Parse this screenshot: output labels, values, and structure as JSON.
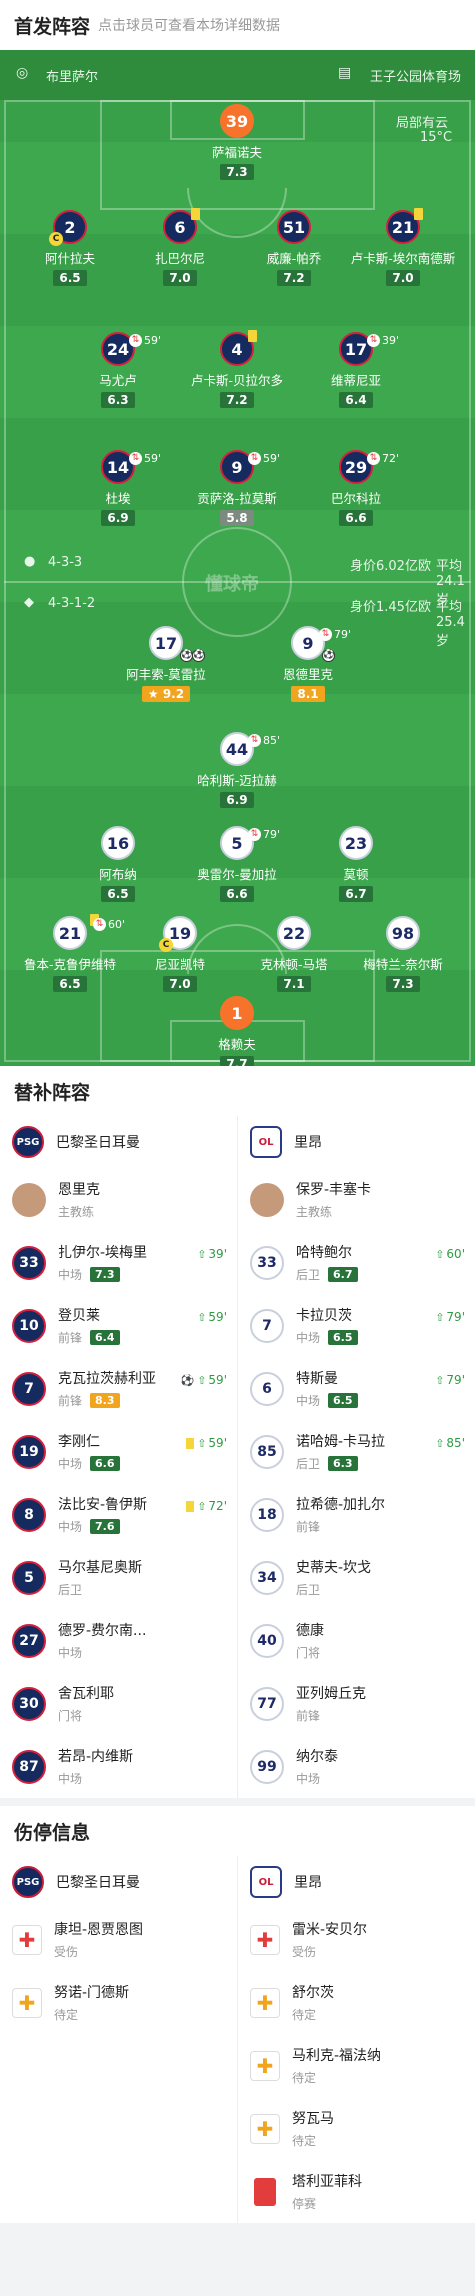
{
  "lineup_header": {
    "title": "首发阵容",
    "subtitle": "点击球员可查看本场详细数据"
  },
  "field": {
    "referee": "布里萨尔",
    "venue": "王子公园体育场",
    "weather": "局部有云",
    "temperature": "15°C",
    "watermark": "懂球帝",
    "psg_formation": "4-3-3",
    "psg_value": "身价6.02亿欧",
    "psg_age": "平均24.1岁",
    "lyon_formation": "4-3-1-2",
    "lyon_value": "身价1.45亿欧",
    "lyon_age": "平均25.4岁"
  },
  "psg_players": [
    {
      "num": "39",
      "name": "萨福诺夫",
      "rating": "7.3",
      "gk": true
    },
    {
      "num": "2",
      "name": "阿什拉夫",
      "rating": "6.5",
      "captain": true
    },
    {
      "num": "6",
      "name": "扎巴尔尼",
      "rating": "7.0",
      "card": true
    },
    {
      "num": "51",
      "name": "威廉-帕乔",
      "rating": "7.2"
    },
    {
      "num": "21",
      "name": "卢卡斯-埃尔南德斯",
      "rating": "7.0",
      "card": true
    },
    {
      "num": "24",
      "name": "马尤卢",
      "rating": "6.3",
      "sub": "59'"
    },
    {
      "num": "4",
      "name": "卢卡斯-贝拉尔多",
      "rating": "7.2",
      "card": true
    },
    {
      "num": "17",
      "name": "维蒂尼亚",
      "rating": "6.4",
      "sub": "39'"
    },
    {
      "num": "14",
      "name": "杜埃",
      "rating": "6.9",
      "sub": "59'"
    },
    {
      "num": "9",
      "name": "贡萨洛-拉莫斯",
      "rating": "5.8",
      "sub": "59'",
      "low": true
    },
    {
      "num": "29",
      "name": "巴尔科拉",
      "rating": "6.6",
      "sub": "72'"
    }
  ],
  "lyon_players": [
    {
      "num": "17",
      "name": "阿丰索-莫雷拉",
      "rating": "9.2",
      "star": true
    },
    {
      "num": "9",
      "name": "恩德里克",
      "rating": "8.1",
      "sub": "79'"
    },
    {
      "num": "44",
      "name": "哈利斯-迈拉赫",
      "rating": "6.9",
      "sub": "85'"
    },
    {
      "num": "16",
      "name": "阿布纳",
      "rating": "6.5"
    },
    {
      "num": "5",
      "name": "奥雷尔-曼加拉",
      "rating": "6.6",
      "sub": "79'"
    },
    {
      "num": "23",
      "name": "莫顿",
      "rating": "6.7"
    },
    {
      "num": "21",
      "name": "鲁本-克鲁伊维特",
      "rating": "6.5",
      "sub": "60'",
      "card": true
    },
    {
      "num": "19",
      "name": "尼亚凯特",
      "rating": "7.0",
      "captain": true
    },
    {
      "num": "22",
      "name": "克林顿-马塔",
      "rating": "7.1"
    },
    {
      "num": "98",
      "name": "梅特兰-奈尔斯",
      "rating": "7.3"
    },
    {
      "num": "1",
      "name": "格赖夫",
      "rating": "7.7",
      "gk": true
    }
  ],
  "subs_header": {
    "title": "替补阵容"
  },
  "teams": {
    "psg": "巴黎圣日耳曼",
    "lyon": "里昂",
    "psg_abbr": "PSG",
    "lyon_abbr": "OL"
  },
  "psg_subs": [
    {
      "num": "",
      "name": "恩里克",
      "pos": "主教练",
      "coach": true
    },
    {
      "num": "33",
      "name": "扎伊尔-埃梅里",
      "pos": "中场",
      "rating": "7.3",
      "event": "39'"
    },
    {
      "num": "10",
      "name": "登贝莱",
      "pos": "前锋",
      "rating": "6.4",
      "event": "59'"
    },
    {
      "num": "7",
      "name": "克瓦拉茨赫利亚",
      "pos": "前锋",
      "rating": "8.3",
      "event": "59'",
      "goal": true,
      "high": true
    },
    {
      "num": "19",
      "name": "李刚仁",
      "pos": "中场",
      "rating": "6.6",
      "event": "59'",
      "card": true
    },
    {
      "num": "8",
      "name": "法比安-鲁伊斯",
      "pos": "中场",
      "rating": "7.6",
      "event": "72'",
      "card": true
    },
    {
      "num": "5",
      "name": "马尔基尼奥斯",
      "pos": "后卫"
    },
    {
      "num": "27",
      "name": "德罗-费尔南...",
      "pos": "中场"
    },
    {
      "num": "30",
      "name": "舍瓦利耶",
      "pos": "门将"
    },
    {
      "num": "87",
      "name": "若昂-内维斯",
      "pos": "中场"
    }
  ],
  "lyon_subs": [
    {
      "num": "",
      "name": "保罗-丰塞卡",
      "pos": "主教练",
      "coach": true
    },
    {
      "num": "33",
      "name": "哈特鲍尔",
      "pos": "后卫",
      "rating": "6.7",
      "event": "60'"
    },
    {
      "num": "7",
      "name": "卡拉贝茨",
      "pos": "中场",
      "rating": "6.5",
      "event": "79'"
    },
    {
      "num": "6",
      "name": "特斯曼",
      "pos": "中场",
      "rating": "6.5",
      "event": "79'"
    },
    {
      "num": "85",
      "name": "诺哈姆-卡马拉",
      "pos": "后卫",
      "rating": "6.3",
      "event": "85'"
    },
    {
      "num": "18",
      "name": "拉希德-加扎尔",
      "pos": "前锋"
    },
    {
      "num": "34",
      "name": "史蒂夫-坎戈",
      "pos": "后卫"
    },
    {
      "num": "40",
      "name": "德康",
      "pos": "门将"
    },
    {
      "num": "77",
      "name": "亚列姆丘克",
      "pos": "前锋"
    },
    {
      "num": "99",
      "name": "纳尔泰",
      "pos": "中场"
    }
  ],
  "injury_header": {
    "title": "伤停信息"
  },
  "psg_injuries": [
    {
      "name": "康坦-恩贾恩图",
      "status": "受伤",
      "kind": "injury"
    },
    {
      "name": "努诺-门德斯",
      "status": "待定",
      "kind": "doubt"
    }
  ],
  "lyon_injuries": [
    {
      "name": "雷米-安贝尔",
      "status": "受伤",
      "kind": "injury"
    },
    {
      "name": "舒尔茨",
      "status": "待定",
      "kind": "doubt"
    },
    {
      "name": "马利克-福法纳",
      "status": "待定",
      "kind": "doubt"
    },
    {
      "name": "努瓦马",
      "status": "待定",
      "kind": "doubt"
    },
    {
      "name": "塔利亚菲科",
      "status": "停赛",
      "kind": "suspended"
    }
  ],
  "colors": {
    "pitch": "#38a048",
    "psg_primary": "#152a5e",
    "psg_accent": "#d4203c",
    "rating_bg": "#27733a",
    "rating_high": "#f1a41d"
  }
}
